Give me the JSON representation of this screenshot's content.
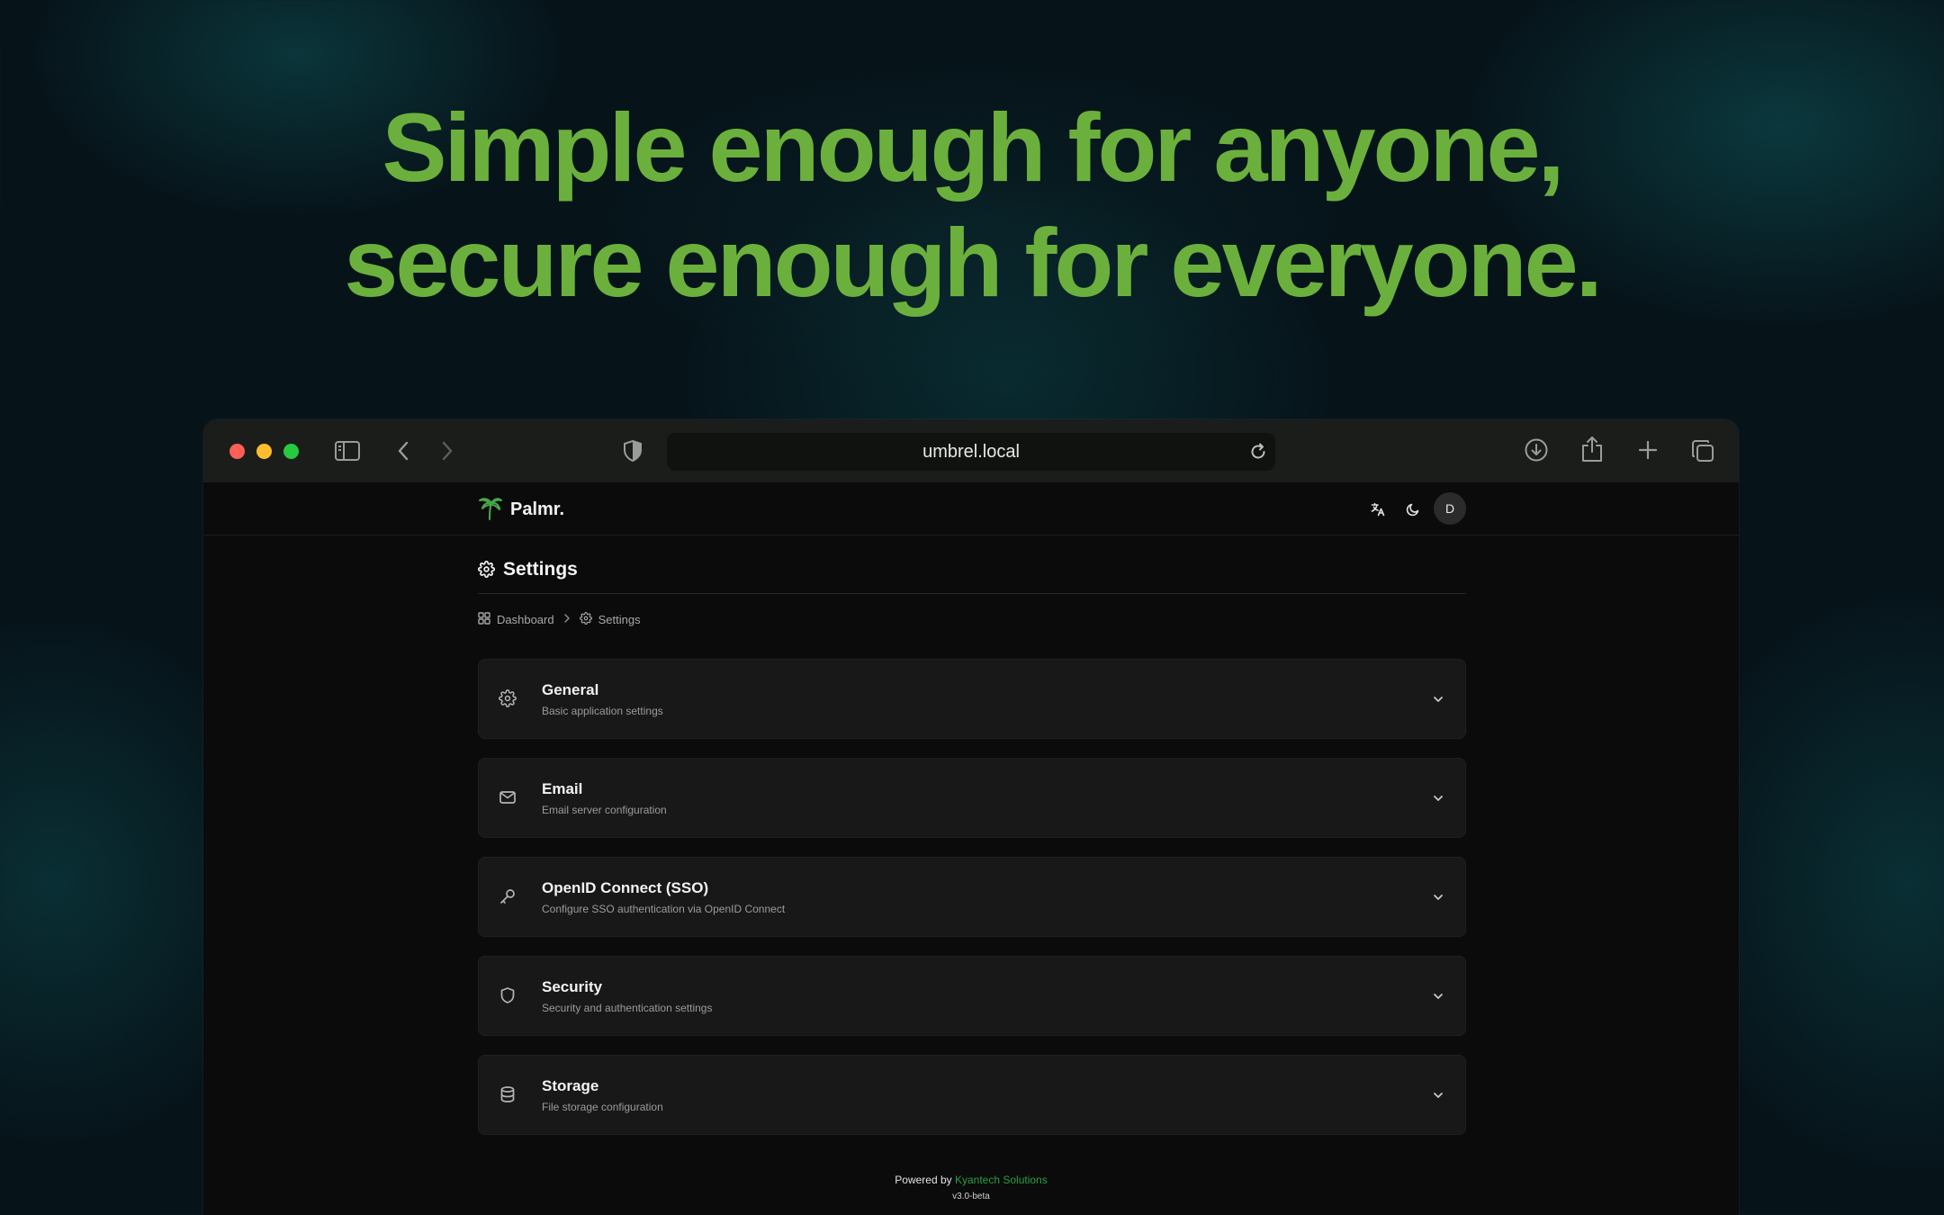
{
  "hero": {
    "line1": "Simple enough for anyone,",
    "line2": "secure enough for everyone."
  },
  "browser": {
    "url": "umbrel.local",
    "icons": [
      "sidebar-icon",
      "back-icon",
      "forward-icon",
      "privacy-shield-icon",
      "reload-icon",
      "download-icon",
      "share-icon",
      "new-tab-icon",
      "tabs-overview-icon"
    ]
  },
  "app": {
    "logo_text": "Palmr.",
    "avatar_initial": "D",
    "header_icons": [
      "language-icon",
      "moon-icon"
    ]
  },
  "page": {
    "title": "Settings",
    "breadcrumb": {
      "home": "Dashboard",
      "current": "Settings"
    }
  },
  "sections": [
    {
      "title": "General",
      "description": "Basic application settings",
      "icon": "gear-icon"
    },
    {
      "title": "Email",
      "description": "Email server configuration",
      "icon": "mail-icon"
    },
    {
      "title": "OpenID Connect (SSO)",
      "description": "Configure SSO authentication via OpenID Connect",
      "icon": "key-icon"
    },
    {
      "title": "Security",
      "description": "Security and authentication settings",
      "icon": "shield-icon"
    },
    {
      "title": "Storage",
      "description": "File storage configuration",
      "icon": "database-icon"
    }
  ],
  "footer": {
    "powered_prefix": "Powered by",
    "powered_brand": "Kyantech Solutions",
    "version": "v3.0-beta"
  },
  "colors": {
    "accent_green": "#6bb03c",
    "brand_green": "#2e9e45",
    "close_light": "#fe5f57",
    "minimize_light": "#febc2e",
    "zoom_light": "#28c840"
  }
}
